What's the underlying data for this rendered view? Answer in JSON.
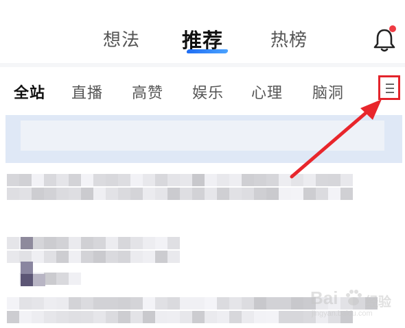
{
  "top_tabs": {
    "items": [
      {
        "label": "想法"
      },
      {
        "label": "推荐"
      },
      {
        "label": "热榜"
      }
    ],
    "active_index": 1,
    "notification_icon": "bell-icon",
    "notification_dot_color": "#ef3b43"
  },
  "category_bar": {
    "items": [
      {
        "label": "全站"
      },
      {
        "label": "直播"
      },
      {
        "label": "高赞"
      },
      {
        "label": "娱乐"
      },
      {
        "label": "心理"
      },
      {
        "label": "脑洞"
      }
    ],
    "active_index": 0,
    "menu_icon": "hamburger-menu-icon",
    "highlight_color": "#e3242b"
  },
  "annotation": {
    "arrow_color": "#e8262c"
  },
  "watermark": {
    "brand": "Bai",
    "brand_suffix": "经验",
    "url": "jingyan.baidu.com"
  },
  "accent_color": "#1f6df3"
}
